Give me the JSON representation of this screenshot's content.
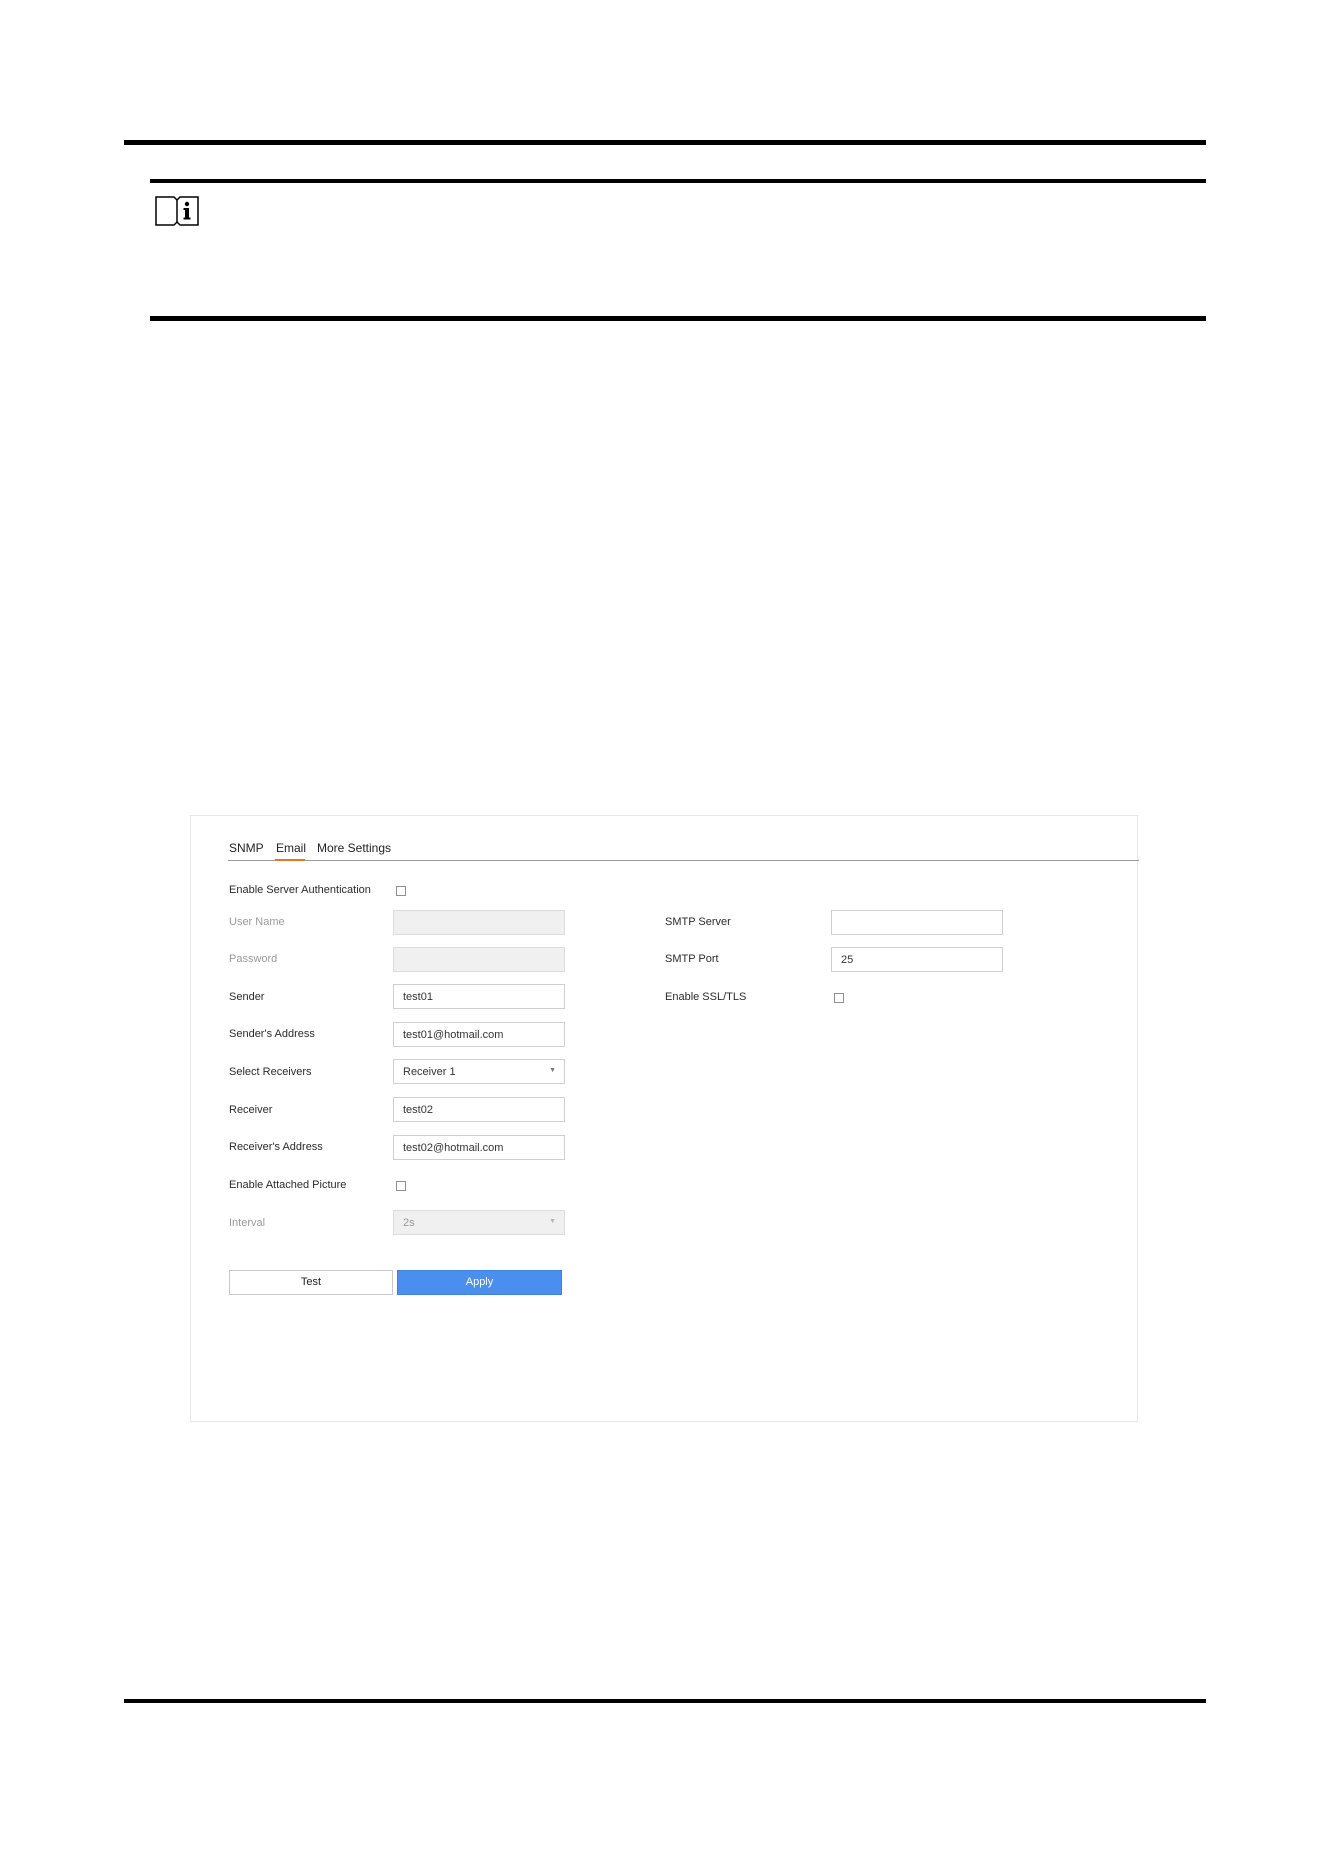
{
  "tabs": [
    {
      "label": "SNMP",
      "active": false
    },
    {
      "label": "Email",
      "active": true
    },
    {
      "label": "More Settings",
      "active": false
    }
  ],
  "form": {
    "enable_server_auth": {
      "label": "Enable Server Authentication",
      "checked": false
    },
    "user_name": {
      "label": "User Name",
      "value": "",
      "disabled": true
    },
    "password": {
      "label": "Password",
      "value": "",
      "disabled": true
    },
    "sender": {
      "label": "Sender",
      "value": "test01"
    },
    "sender_address": {
      "label": "Sender's Address",
      "value": "test01@hotmail.com"
    },
    "select_receivers": {
      "label": "Select Receivers",
      "value": "Receiver 1"
    },
    "receiver": {
      "label": "Receiver",
      "value": "test02"
    },
    "receiver_address": {
      "label": "Receiver's Address",
      "value": "test02@hotmail.com"
    },
    "enable_attached_picture": {
      "label": "Enable Attached Picture",
      "checked": false
    },
    "interval": {
      "label": "Interval",
      "value": "2s",
      "disabled": true
    },
    "smtp_server": {
      "label": "SMTP Server",
      "value": ""
    },
    "smtp_port": {
      "label": "SMTP Port",
      "value": "25"
    },
    "enable_ssl_tls": {
      "label": "Enable SSL/TLS",
      "checked": false
    }
  },
  "buttons": {
    "test_label": "Test",
    "apply_label": "Apply"
  },
  "icons": {
    "note": "book-info-icon",
    "dropdown": "caret-down-icon"
  },
  "colors": {
    "accent_tab": "#e07a26",
    "apply_button": "#4a8ef0",
    "disabled_field": "#f0f0f0"
  }
}
